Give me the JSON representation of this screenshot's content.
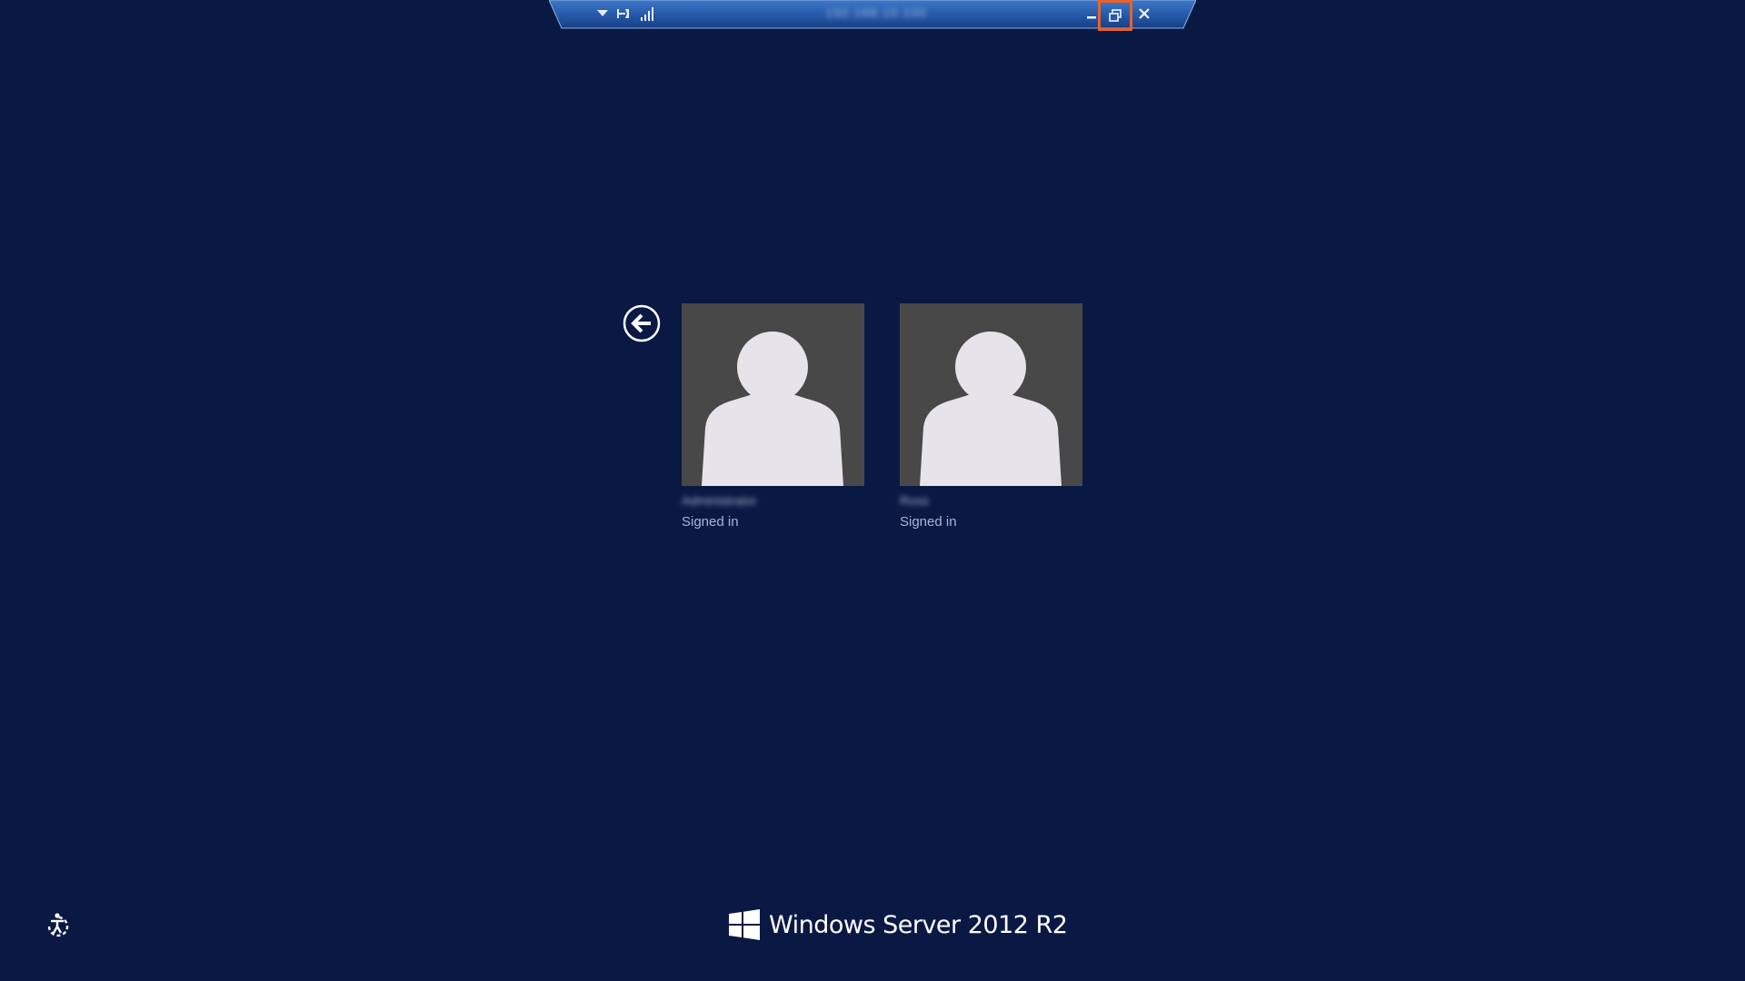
{
  "connection_bar": {
    "title": "192.168.10.100",
    "pin_icon": "pin-icon",
    "signal_icon": "connection-quality-icon",
    "dropdown_icon": "chevron-down-icon",
    "minimize_icon": "minimize-icon",
    "restore_icon": "restore-down-icon",
    "close_icon": "close-icon",
    "restore_highlighted": true,
    "highlight_color": "#e8622a"
  },
  "back_button": {
    "icon": "back-arrow-icon"
  },
  "users": [
    {
      "name": "Administrator",
      "status": "Signed in",
      "avatar_icon": "user-silhouette-icon"
    },
    {
      "name": "Ross",
      "status": "Signed in",
      "avatar_icon": "user-silhouette-icon"
    }
  ],
  "ease_of_access": {
    "icon": "ease-of-access-icon"
  },
  "branding": {
    "logo_icon": "windows-logo-icon",
    "product_name": "Windows Server 2012 R2"
  },
  "colors": {
    "background": "#0a1944",
    "tile": "#484848",
    "silhouette": "#e6e3ea",
    "status_text": "#a9b6d4",
    "bar_blue": "#2d63b8"
  }
}
